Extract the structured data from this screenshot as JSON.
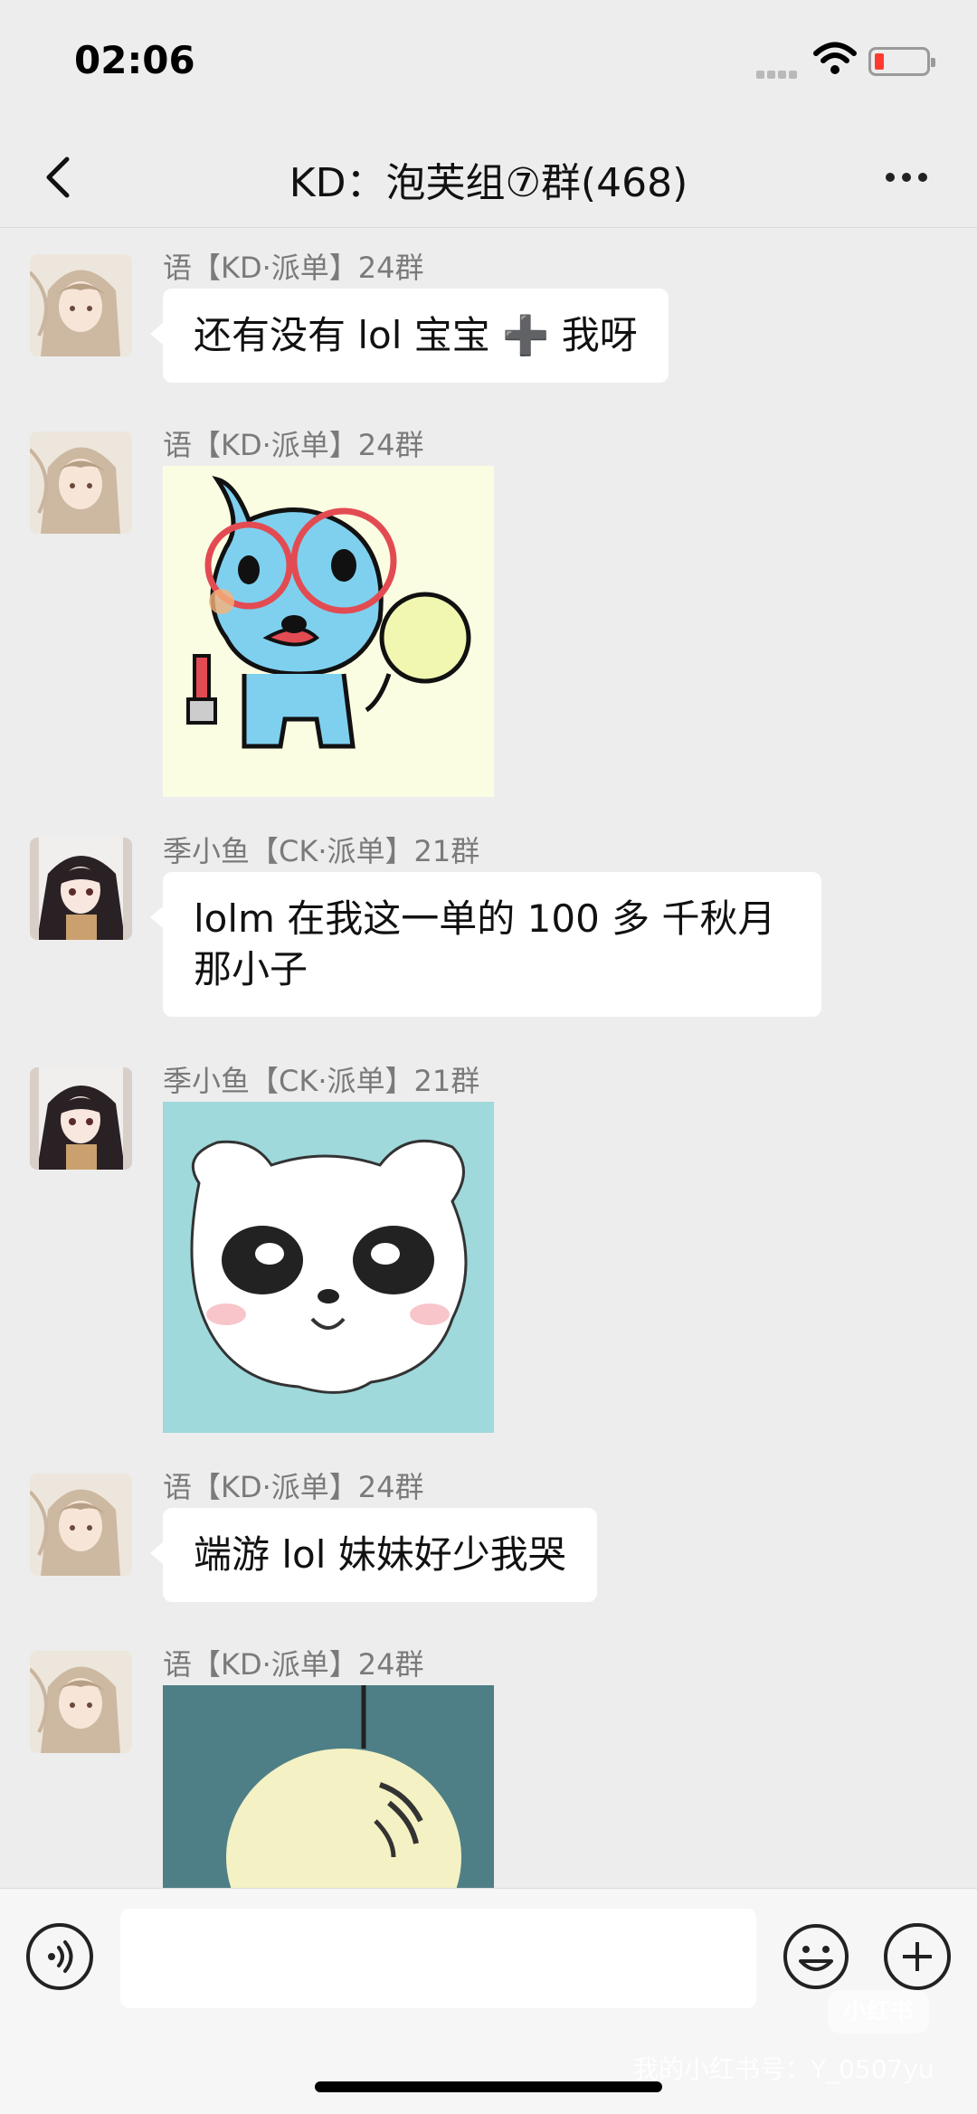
{
  "status_bar": {
    "time": "02:06"
  },
  "header": {
    "title": "KD：泡芙组⑦群(468)"
  },
  "messages": [
    {
      "sender": "语【KD·派单】24群",
      "type": "text",
      "text": "还有没有 lol 宝宝 ➕ 我呀",
      "avatar": "anime-girl-light-hair"
    },
    {
      "sender": "语【KD·派单】24群",
      "type": "sticker",
      "sticker": "blue-bird-with-glasses-sticker",
      "avatar": "anime-girl-light-hair"
    },
    {
      "sender": "季小鱼【CK·派单】21群",
      "type": "text",
      "text": "lolm 在我这一单的 100 多 千秋月那小子",
      "avatar": "anime-girl-dark-hair"
    },
    {
      "sender": "季小鱼【CK·派单】21群",
      "type": "sticker",
      "sticker": "white-dog-face-sticker",
      "avatar": "anime-girl-dark-hair"
    },
    {
      "sender": "语【KD·派单】24群",
      "type": "text",
      "text": "端游 lol 妹妹好少我哭",
      "avatar": "anime-girl-light-hair"
    },
    {
      "sender": "语【KD·派单】24群",
      "type": "sticker",
      "sticker": "yellow-blob-face-sticker",
      "avatar": "anime-girl-light-hair"
    }
  ],
  "input_bar": {
    "voice_icon": "voice-icon",
    "emoji_icon": "emoji-icon",
    "plus_icon": "plus-icon"
  },
  "watermark": {
    "logo": "小红书",
    "text": "我的小红书号：Y_0507yu"
  }
}
